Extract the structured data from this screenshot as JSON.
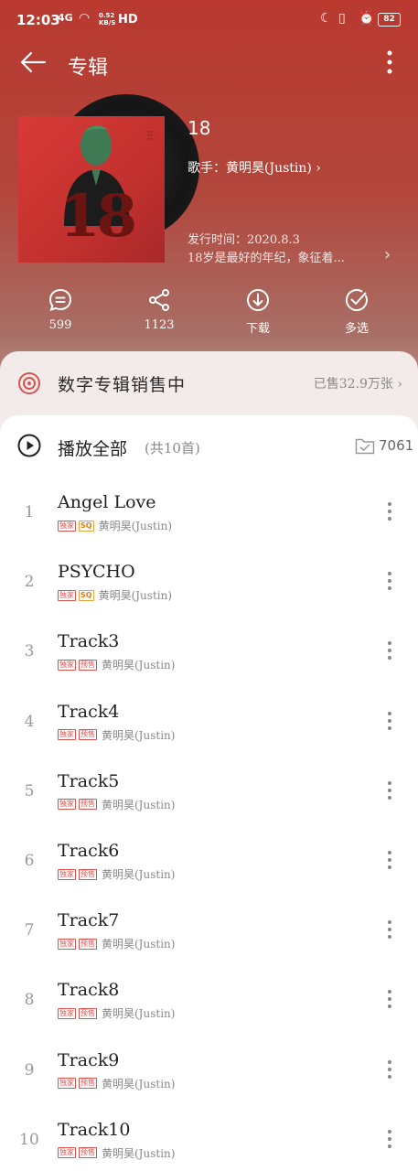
{
  "status_bar": {
    "time": "12:03",
    "signal": "4G",
    "speed_top": "0.52",
    "speed_bottom": "KB/S",
    "hd": "HD",
    "battery": "82"
  },
  "nav": {
    "title": "专辑"
  },
  "album": {
    "cover_number": "18",
    "title": "18",
    "artist_line": "歌手：黄明昊(Justin) ›",
    "release_line": "发行时间：2020.8.3",
    "description": "18岁是最好的年纪，象征着...",
    "description_chevron": "›"
  },
  "actions": [
    {
      "label": "599",
      "icon": "comment-icon"
    },
    {
      "label": "1123",
      "icon": "share-icon"
    },
    {
      "label": "下载",
      "icon": "download-icon"
    },
    {
      "label": "多选",
      "icon": "multi-select-icon"
    }
  ],
  "sales": {
    "text": "数字专辑销售中",
    "count": "已售32.9万张 ›"
  },
  "playlist": {
    "play_all": "播放全部",
    "count": "(共10首)",
    "favorites": "7061"
  },
  "tracks": [
    {
      "num": "1",
      "title": "Angel Love",
      "badges": [
        "独家",
        "SQ"
      ],
      "artist": "黄明昊(Justin)"
    },
    {
      "num": "2",
      "title": "PSYCHO",
      "badges": [
        "独家",
        "SQ"
      ],
      "artist": "黄明昊(Justin)"
    },
    {
      "num": "3",
      "title": "Track3",
      "badges": [
        "独家",
        "预售"
      ],
      "artist": "黄明昊(Justin)"
    },
    {
      "num": "4",
      "title": "Track4",
      "badges": [
        "独家",
        "预售"
      ],
      "artist": "黄明昊(Justin)"
    },
    {
      "num": "5",
      "title": "Track5",
      "badges": [
        "独家",
        "预售"
      ],
      "artist": "黄明昊(Justin)"
    },
    {
      "num": "6",
      "title": "Track6",
      "badges": [
        "独家",
        "预售"
      ],
      "artist": "黄明昊(Justin)"
    },
    {
      "num": "7",
      "title": "Track7",
      "badges": [
        "独家",
        "预售"
      ],
      "artist": "黄明昊(Justin)"
    },
    {
      "num": "8",
      "title": "Track8",
      "badges": [
        "独家",
        "预售"
      ],
      "artist": "黄明昊(Justin)"
    },
    {
      "num": "9",
      "title": "Track9",
      "badges": [
        "独家",
        "预售"
      ],
      "artist": "黄明昊(Justin)"
    },
    {
      "num": "10",
      "title": "Track10",
      "badges": [
        "独家",
        "预售"
      ],
      "artist": "黄明昊(Justin)"
    }
  ],
  "colors": {
    "hero_red": "#b9392f",
    "accent_red": "#d9534f",
    "sq_orange": "#e07a1a"
  }
}
